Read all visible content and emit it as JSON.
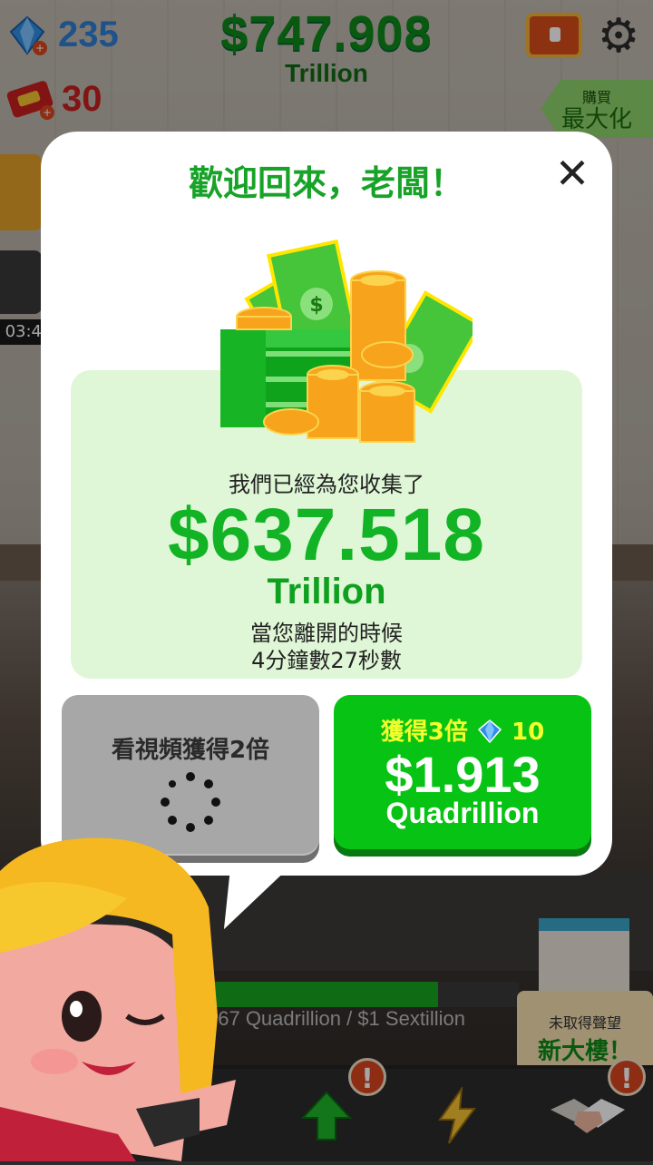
{
  "hud": {
    "gems": "235",
    "tickets": "30",
    "total_amount": "$747.908",
    "total_unit": "Trillion",
    "side_timer": "03:4",
    "buy_label": "購買",
    "buy_action": "最大化"
  },
  "dialog": {
    "title": "歡迎回來，老闆！",
    "close": "✕",
    "collected_label": "我們已經為您收集了",
    "amount": "$637.518",
    "unit": "Trillion",
    "away_line1": "當您離開的時候",
    "away_line2": "4分鐘數27秒數",
    "video_button": "看視頻獲得2倍",
    "triple_label": "獲得3倍",
    "triple_cost": "10",
    "triple_amount": "$1.913",
    "triple_unit": "Quadrillion"
  },
  "bottom": {
    "progress_text": "067 Quadrillion / $1 Sextillion",
    "progress_fraction": 0.74,
    "sign_small": "未取得聲望",
    "sign_big": "新大樓！",
    "badge": "!"
  },
  "colors": {
    "title_green": "#17a327",
    "amount_green": "#13b326",
    "triple_button": "#07c313",
    "video_button": "#a7a7a7",
    "gem_blue": "#2f8fe6",
    "ticket_red": "#c92020"
  },
  "icons": [
    "gem-icon",
    "ticket-icon",
    "chest-icon",
    "gear-icon",
    "close-icon",
    "money-stack-icon",
    "loading-spinner-icon",
    "arrow-up-icon",
    "lightning-icon",
    "handshake-icon"
  ]
}
